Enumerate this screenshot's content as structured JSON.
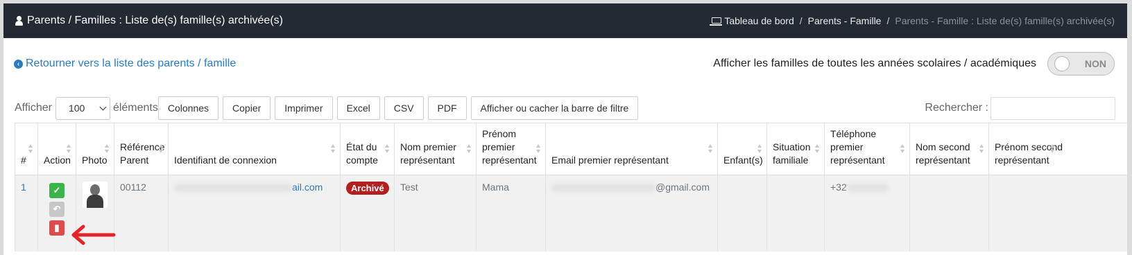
{
  "header": {
    "title": "Parents / Familles : Liste de(s) famille(s) archivée(s)",
    "breadcrumb": [
      "Tableau de bord",
      "Parents - Famille",
      "Parents - Famille : Liste de(s) famille(s) archivée(s)"
    ]
  },
  "back_link": "Retourner vers la liste des parents / famille",
  "toggle": {
    "label": "Afficher les familles de toutes les années scolaires / académiques",
    "state": "NON"
  },
  "controls": {
    "show_label": "Afficher",
    "page_size": "100",
    "elements_label": "éléments",
    "buttons": [
      "Colonnes",
      "Copier",
      "Imprimer",
      "Excel",
      "CSV",
      "PDF",
      "Afficher ou cacher la barre de filtre"
    ],
    "search_label": "Rechercher :"
  },
  "table": {
    "columns": [
      "#",
      "Action",
      "Photo",
      "Référence Parent",
      "Identifiant de connexion",
      "État du compte",
      "Nom premier représentant",
      "Prénom premier représentant",
      "Email premier représentant",
      "Enfant(s)",
      "Situation familiale",
      "Téléphone premier représentant",
      "Nom second représentant",
      "Prénom second représentant"
    ],
    "rows": [
      {
        "num": "1",
        "reference": "00112",
        "login": "ail.com",
        "status": "Archivé",
        "first_name_1": "Test",
        "prenom_1": "Mama",
        "email": "@gmail.com",
        "children": "",
        "situation": "",
        "phone": "+32",
        "name_2": "",
        "prenom_2": ""
      }
    ]
  },
  "colors": {
    "topbar": "#232a33",
    "link": "#2b7bc0",
    "badge": "#b21f1f",
    "annotation_arrow": "#e0262b"
  }
}
